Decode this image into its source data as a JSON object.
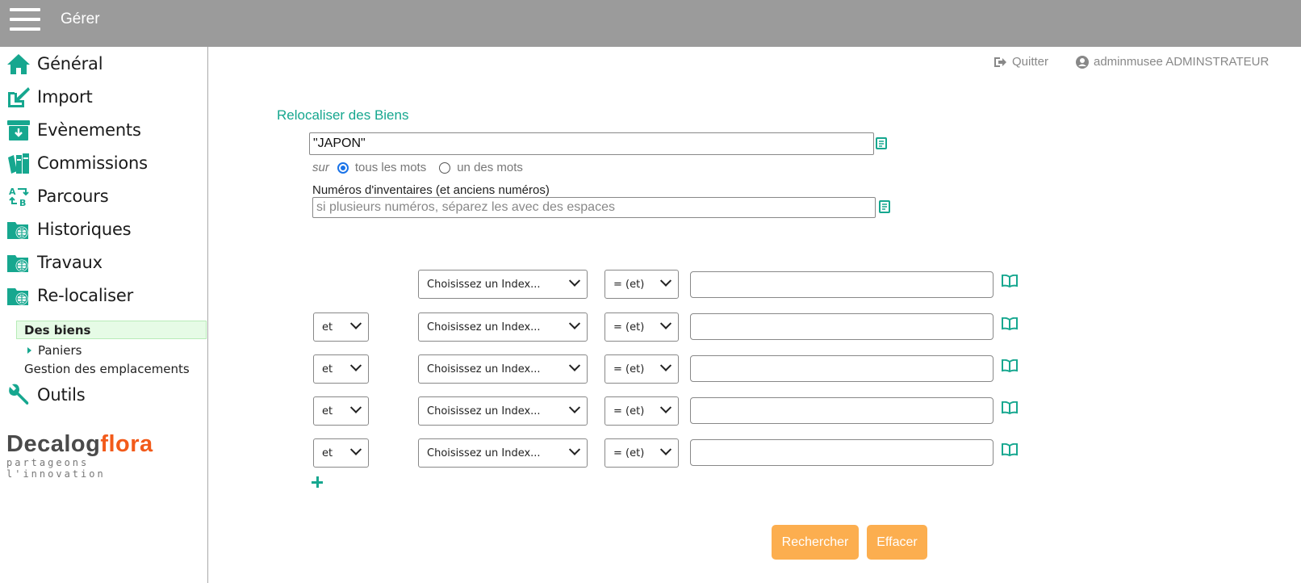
{
  "header": {
    "title": "Gérer",
    "menu_icon": "hamburger-menu-icon"
  },
  "sidebar": {
    "items": [
      {
        "label": "Général",
        "icon": "home-icon"
      },
      {
        "label": "Import",
        "icon": "import-icon"
      },
      {
        "label": "Evènements",
        "icon": "archive-box-icon"
      },
      {
        "label": "Commissions",
        "icon": "books-icon"
      },
      {
        "label": "Parcours",
        "icon": "route-ab-icon"
      },
      {
        "label": "Historiques",
        "icon": "folder-globe-icon"
      },
      {
        "label": "Travaux",
        "icon": "folder-globe-icon"
      },
      {
        "label": "Re-localiser",
        "icon": "folder-globe-icon"
      },
      {
        "label": "Outils",
        "icon": "wrench-icon"
      }
    ],
    "sub_items": {
      "active": "Des biens",
      "paniers": "Paniers",
      "emplacements": "Gestion des emplacements"
    },
    "logo": {
      "brand_part1": "Decalog",
      "brand_part2": "flora",
      "tagline": "partageons l'innovation"
    }
  },
  "topright": {
    "quit_label": "Quitter",
    "user_label": "adminmusee ADMINSTRATEUR"
  },
  "main": {
    "section_title": "Relocaliser des Biens",
    "search_value": "\"JAPON\"",
    "sur_label": "sur",
    "radio_all": "tous les mots",
    "radio_one": "un des mots",
    "radio_selected": "tous les mots",
    "inventory_label": "Numéros d'inventaires (et anciens numéros)",
    "inventory_placeholder": "si plusieurs numéros, séparez les avec des espaces",
    "criteria_rows": [
      {
        "connector": "",
        "index": "Choisissez un Index...",
        "operator": "= (et)",
        "value": ""
      },
      {
        "connector": "et",
        "index": "Choisissez un Index...",
        "operator": "= (et)",
        "value": ""
      },
      {
        "connector": "et",
        "index": "Choisissez un Index...",
        "operator": "= (et)",
        "value": ""
      },
      {
        "connector": "et",
        "index": "Choisissez un Index...",
        "operator": "= (et)",
        "value": ""
      },
      {
        "connector": "et",
        "index": "Choisissez un Index...",
        "operator": "= (et)",
        "value": ""
      }
    ],
    "search_button": "Rechercher",
    "clear_button": "Effacer"
  },
  "colors": {
    "accent": "#16a78f",
    "header_bg": "#9b9b9b",
    "button_bg": "#fcae4f",
    "active_bg": "#e6fbe6",
    "logo_orange": "#f25a1a"
  }
}
